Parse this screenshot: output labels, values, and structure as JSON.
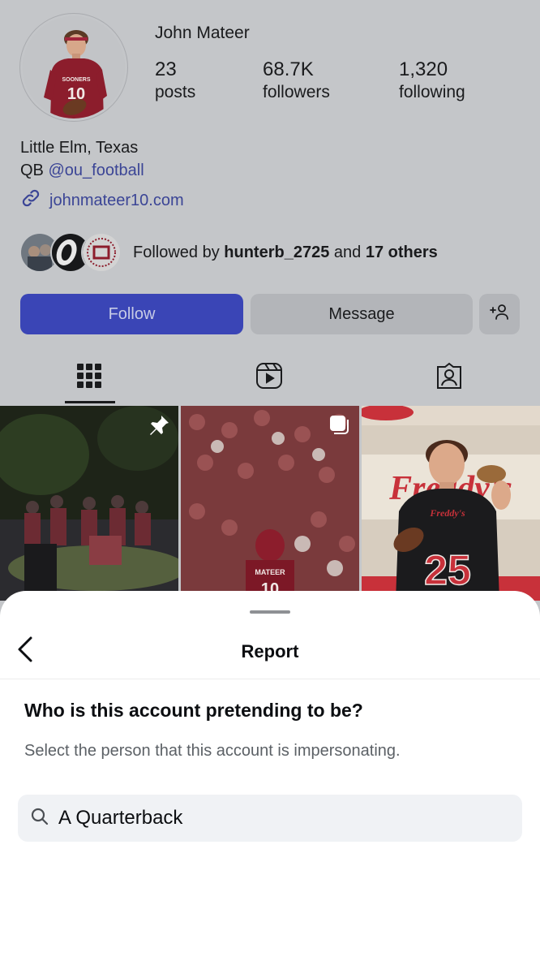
{
  "profile": {
    "name": "John Mateer",
    "stats": [
      {
        "value": "23",
        "label": "posts"
      },
      {
        "value": "68.7K",
        "label": "followers"
      },
      {
        "value": "1,320",
        "label": "following"
      }
    ],
    "bio_location": "Little Elm, Texas",
    "bio_role": "QB",
    "bio_mention": "@ou_football",
    "website": "johnmateer10.com",
    "followed_by_prefix": "Followed by",
    "followed_by_user": "hunterb_2725",
    "followed_by_and": "and",
    "followed_by_others": "17 others"
  },
  "actions": {
    "follow_label": "Follow",
    "message_label": "Message"
  },
  "avatar_text": {
    "jersey_word": "SOONERS",
    "jersey_number": "10"
  },
  "photos": {
    "photo2_name": "MATEER",
    "photo2_number": "10",
    "photo3_sign": "Freddy's",
    "photo3_jersey_brand": "Freddy's",
    "photo3_number": "25"
  },
  "tabs": [
    {
      "icon": "grid-icon",
      "active": true
    },
    {
      "icon": "reels-icon",
      "active": false
    },
    {
      "icon": "tagged-icon",
      "active": false
    }
  ],
  "report": {
    "title": "Report",
    "question": "Who is this account pretending to be?",
    "subtitle": "Select the person that this account is impersonating.",
    "search_value": "A Quarterback"
  },
  "colors": {
    "follow_button": "#3a45b6",
    "link": "#3b4596",
    "overlay_background": "#c4c6c9",
    "sheet_background": "#ffffff",
    "search_background": "#f0f2f5"
  }
}
